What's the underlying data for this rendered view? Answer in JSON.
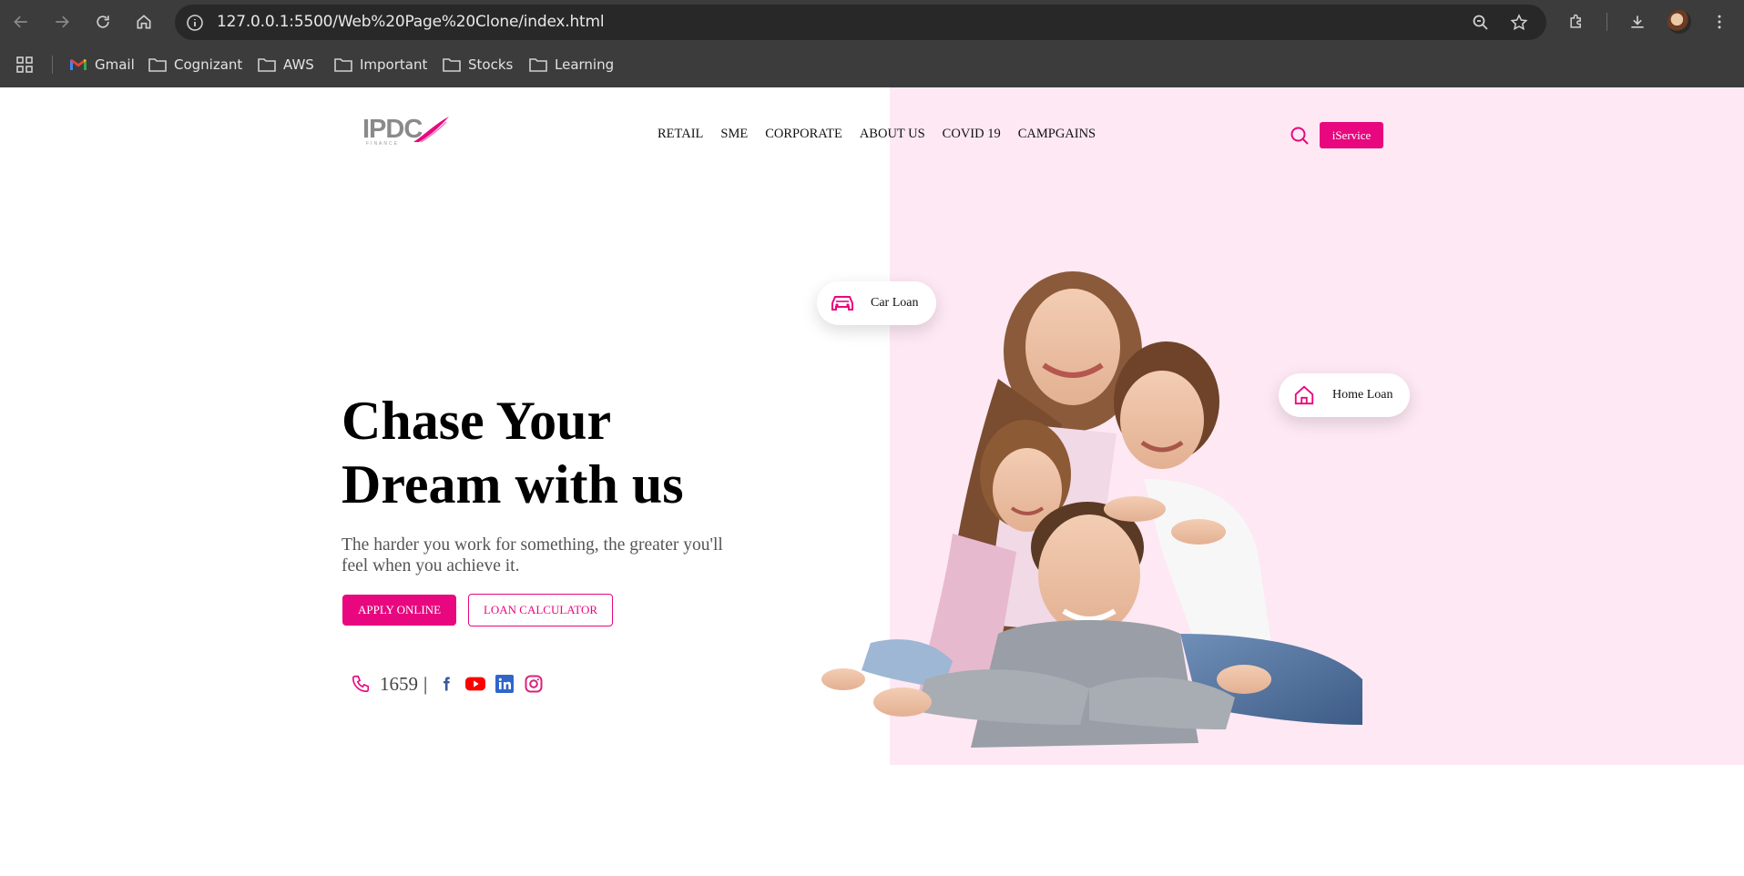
{
  "browser": {
    "url": "127.0.0.1:5500/Web%20Page%20Clone/index.html",
    "bookmarks": [
      {
        "label": "Gmail",
        "icon": "gmail-icon"
      },
      {
        "label": "Cognizant",
        "icon": "folder-icon"
      },
      {
        "label": "AWS",
        "icon": "folder-icon"
      },
      {
        "label": "Important",
        "icon": "folder-icon"
      },
      {
        "label": "Stocks",
        "icon": "folder-icon"
      },
      {
        "label": "Learning",
        "icon": "folder-icon"
      }
    ]
  },
  "site": {
    "logo_text": "IPDC",
    "logo_sub": "FINANCE",
    "nav": [
      "RETAIL",
      "SME",
      "CORPORATE",
      "ABOUT US",
      "COVID 19",
      "CAMPGAINS"
    ],
    "iservice_label": "iService"
  },
  "hero": {
    "title_line1": "Chase Your",
    "title_line2": "Dream with us",
    "subtitle": "The harder you work for something, the greater you'll feel when you achieve it.",
    "apply_label": "APPLY ONLINE",
    "calculator_label": "LOAN CALCULATOR",
    "phone": "1659",
    "separator": "|"
  },
  "chips": {
    "car_loan": "Car Loan",
    "home_loan": "Home Loan"
  },
  "colors": {
    "brand_pink": "#e8077f",
    "pink_panel": "#fde8f3",
    "chrome_bg": "#3c3c3c"
  }
}
